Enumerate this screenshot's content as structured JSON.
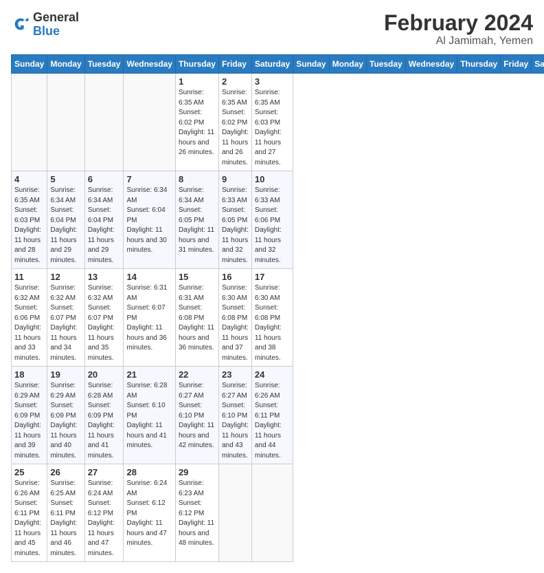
{
  "logo": {
    "general": "General",
    "blue": "Blue"
  },
  "title": "February 2024",
  "location": "Al Jamimah, Yemen",
  "days_of_week": [
    "Sunday",
    "Monday",
    "Tuesday",
    "Wednesday",
    "Thursday",
    "Friday",
    "Saturday"
  ],
  "weeks": [
    [
      {
        "num": "",
        "info": ""
      },
      {
        "num": "",
        "info": ""
      },
      {
        "num": "",
        "info": ""
      },
      {
        "num": "",
        "info": ""
      },
      {
        "num": "1",
        "info": "Sunrise: 6:35 AM\nSunset: 6:02 PM\nDaylight: 11 hours and 26 minutes."
      },
      {
        "num": "2",
        "info": "Sunrise: 6:35 AM\nSunset: 6:02 PM\nDaylight: 11 hours and 26 minutes."
      },
      {
        "num": "3",
        "info": "Sunrise: 6:35 AM\nSunset: 6:03 PM\nDaylight: 11 hours and 27 minutes."
      }
    ],
    [
      {
        "num": "4",
        "info": "Sunrise: 6:35 AM\nSunset: 6:03 PM\nDaylight: 11 hours and 28 minutes."
      },
      {
        "num": "5",
        "info": "Sunrise: 6:34 AM\nSunset: 6:04 PM\nDaylight: 11 hours and 29 minutes."
      },
      {
        "num": "6",
        "info": "Sunrise: 6:34 AM\nSunset: 6:04 PM\nDaylight: 11 hours and 29 minutes."
      },
      {
        "num": "7",
        "info": "Sunrise: 6:34 AM\nSunset: 6:04 PM\nDaylight: 11 hours and 30 minutes."
      },
      {
        "num": "8",
        "info": "Sunrise: 6:34 AM\nSunset: 6:05 PM\nDaylight: 11 hours and 31 minutes."
      },
      {
        "num": "9",
        "info": "Sunrise: 6:33 AM\nSunset: 6:05 PM\nDaylight: 11 hours and 32 minutes."
      },
      {
        "num": "10",
        "info": "Sunrise: 6:33 AM\nSunset: 6:06 PM\nDaylight: 11 hours and 32 minutes."
      }
    ],
    [
      {
        "num": "11",
        "info": "Sunrise: 6:32 AM\nSunset: 6:06 PM\nDaylight: 11 hours and 33 minutes."
      },
      {
        "num": "12",
        "info": "Sunrise: 6:32 AM\nSunset: 6:07 PM\nDaylight: 11 hours and 34 minutes."
      },
      {
        "num": "13",
        "info": "Sunrise: 6:32 AM\nSunset: 6:07 PM\nDaylight: 11 hours and 35 minutes."
      },
      {
        "num": "14",
        "info": "Sunrise: 6:31 AM\nSunset: 6:07 PM\nDaylight: 11 hours and 36 minutes."
      },
      {
        "num": "15",
        "info": "Sunrise: 6:31 AM\nSunset: 6:08 PM\nDaylight: 11 hours and 36 minutes."
      },
      {
        "num": "16",
        "info": "Sunrise: 6:30 AM\nSunset: 6:08 PM\nDaylight: 11 hours and 37 minutes."
      },
      {
        "num": "17",
        "info": "Sunrise: 6:30 AM\nSunset: 6:08 PM\nDaylight: 11 hours and 38 minutes."
      }
    ],
    [
      {
        "num": "18",
        "info": "Sunrise: 6:29 AM\nSunset: 6:09 PM\nDaylight: 11 hours and 39 minutes."
      },
      {
        "num": "19",
        "info": "Sunrise: 6:29 AM\nSunset: 6:09 PM\nDaylight: 11 hours and 40 minutes."
      },
      {
        "num": "20",
        "info": "Sunrise: 6:28 AM\nSunset: 6:09 PM\nDaylight: 11 hours and 41 minutes."
      },
      {
        "num": "21",
        "info": "Sunrise: 6:28 AM\nSunset: 6:10 PM\nDaylight: 11 hours and 41 minutes."
      },
      {
        "num": "22",
        "info": "Sunrise: 6:27 AM\nSunset: 6:10 PM\nDaylight: 11 hours and 42 minutes."
      },
      {
        "num": "23",
        "info": "Sunrise: 6:27 AM\nSunset: 6:10 PM\nDaylight: 11 hours and 43 minutes."
      },
      {
        "num": "24",
        "info": "Sunrise: 6:26 AM\nSunset: 6:11 PM\nDaylight: 11 hours and 44 minutes."
      }
    ],
    [
      {
        "num": "25",
        "info": "Sunrise: 6:26 AM\nSunset: 6:11 PM\nDaylight: 11 hours and 45 minutes."
      },
      {
        "num": "26",
        "info": "Sunrise: 6:25 AM\nSunset: 6:11 PM\nDaylight: 11 hours and 46 minutes."
      },
      {
        "num": "27",
        "info": "Sunrise: 6:24 AM\nSunset: 6:12 PM\nDaylight: 11 hours and 47 minutes."
      },
      {
        "num": "28",
        "info": "Sunrise: 6:24 AM\nSunset: 6:12 PM\nDaylight: 11 hours and 47 minutes."
      },
      {
        "num": "29",
        "info": "Sunrise: 6:23 AM\nSunset: 6:12 PM\nDaylight: 11 hours and 48 minutes."
      },
      {
        "num": "",
        "info": ""
      },
      {
        "num": "",
        "info": ""
      }
    ]
  ]
}
